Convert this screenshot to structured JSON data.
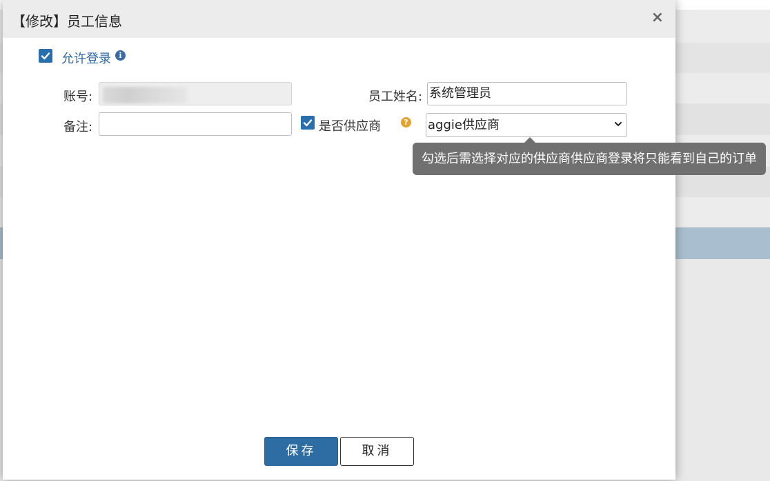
{
  "dialog": {
    "title": "【修改】员工信息",
    "close_symbol": "×"
  },
  "allow_login": {
    "checked": true,
    "label": "允许登录",
    "info_icon": "info-icon"
  },
  "form": {
    "account_label": "账号:",
    "account_value": "",
    "name_label": "员工姓名:",
    "name_value": "系统管理员",
    "remark_label": "备注:",
    "remark_value": "",
    "is_supplier_checked": true,
    "is_supplier_label": "是否供应商",
    "help_icon": "help-icon",
    "supplier_select_value": "aggie供应商"
  },
  "tooltip": {
    "text": "勾选后需选择对应的供应商供应商登录将只能看到自己的订单"
  },
  "buttons": {
    "save_label": "保存",
    "cancel_label": "取消"
  },
  "colors": {
    "primary": "#2e6da4",
    "link_blue": "#2f69a8",
    "help_orange": "#e3a32d",
    "tooltip_bg": "#707070"
  }
}
